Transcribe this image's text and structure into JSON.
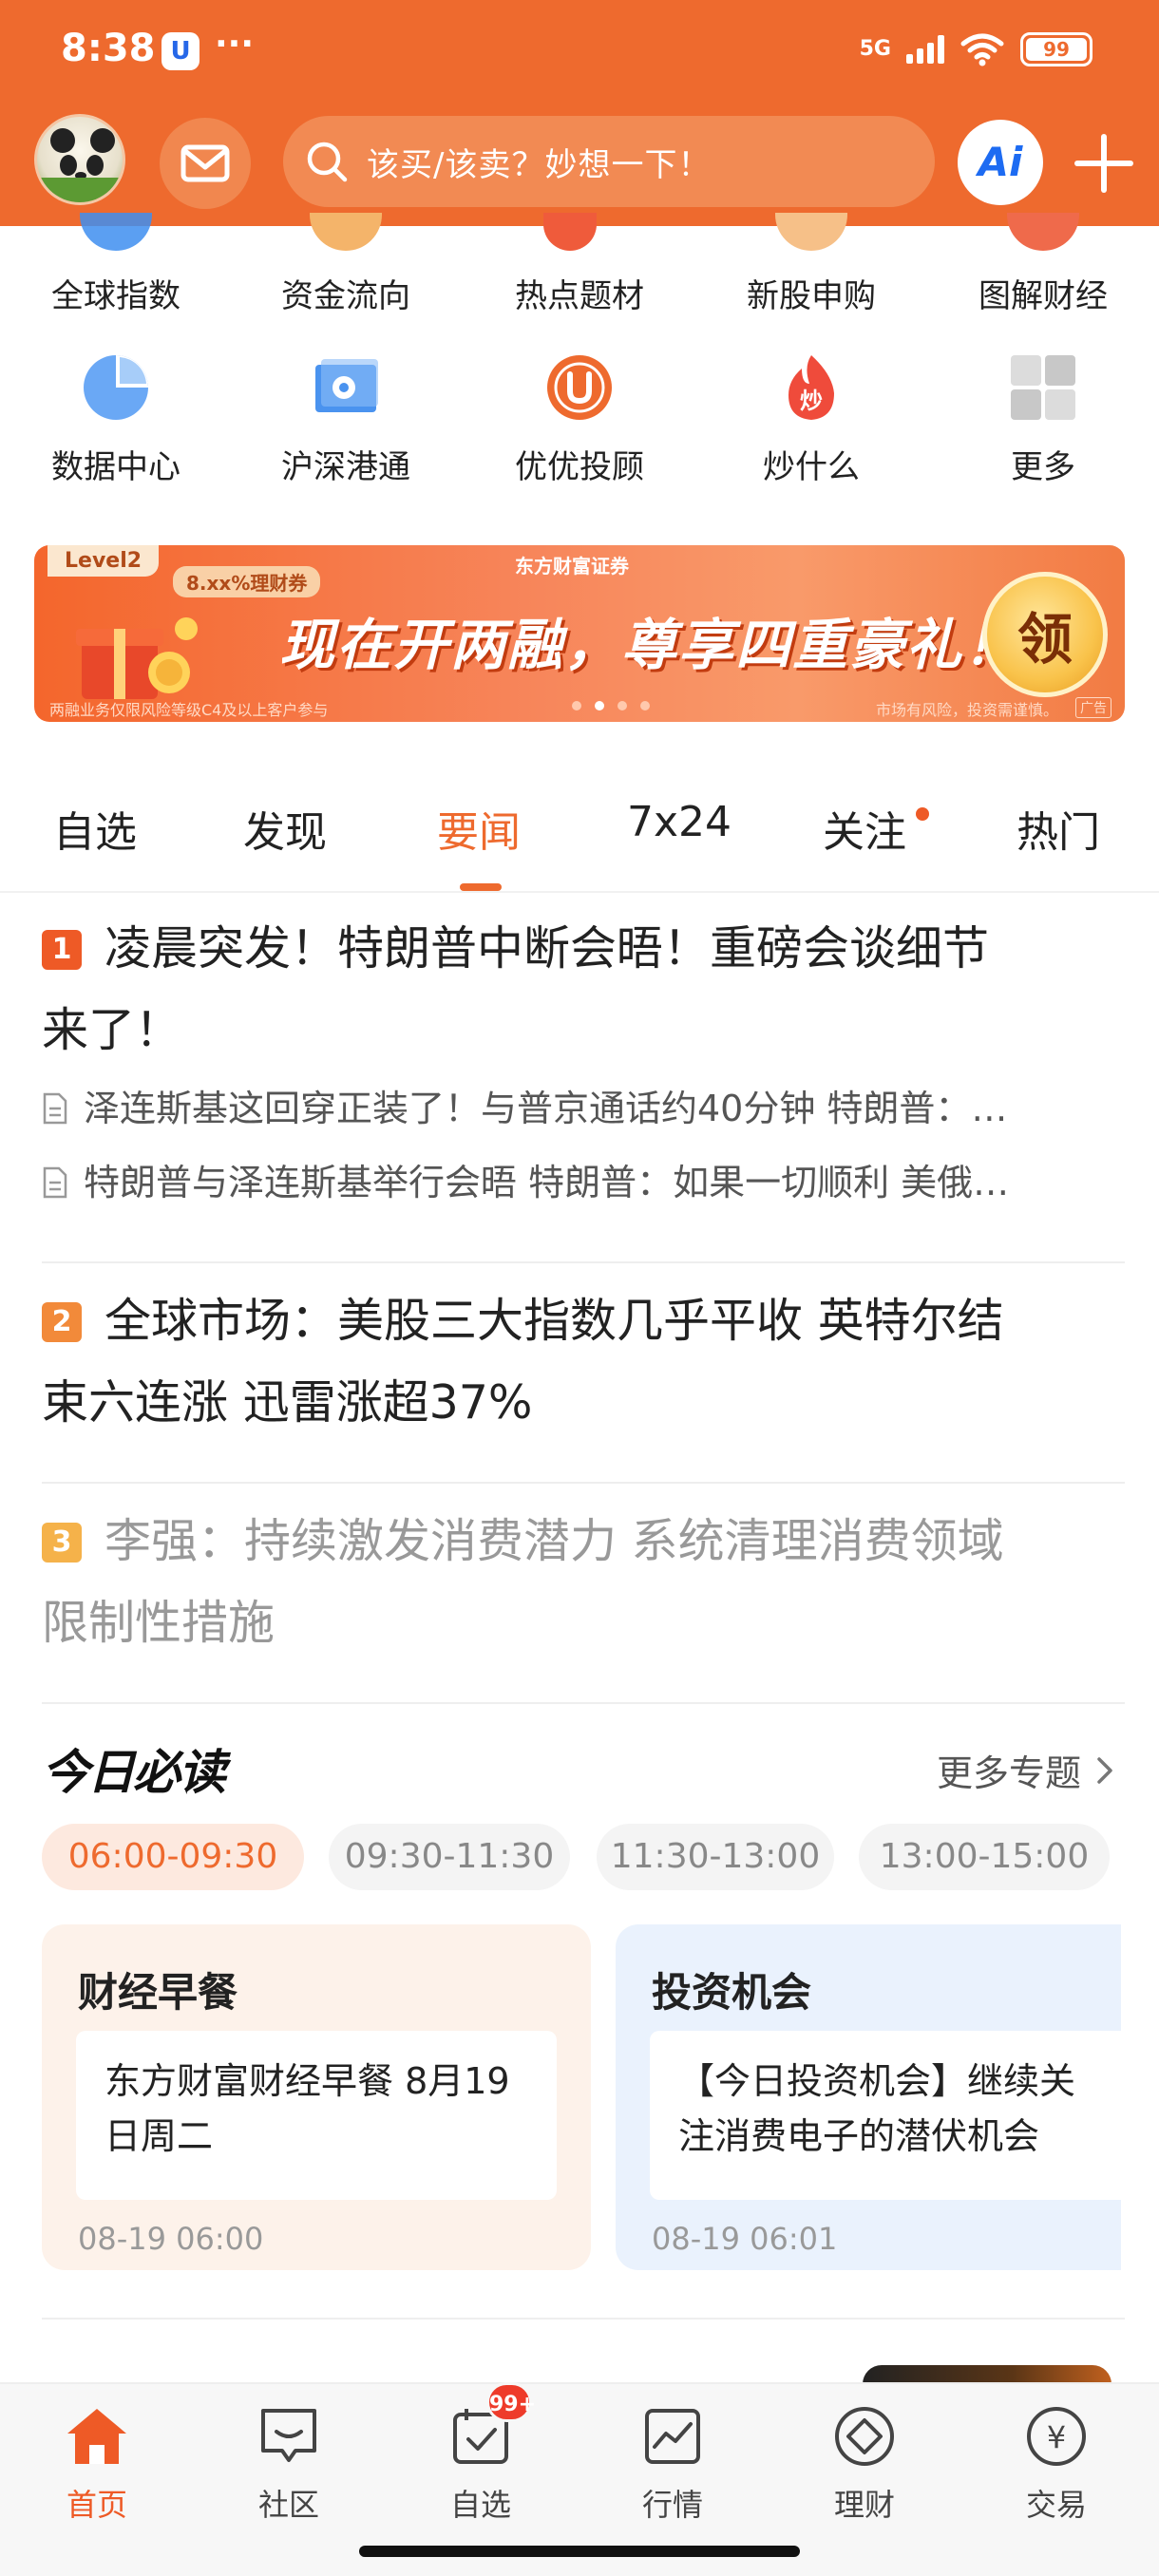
{
  "status_bar": {
    "time": "8:38",
    "dots": "···",
    "network": "5G",
    "battery": "99"
  },
  "header": {
    "search_placeholder": "该买/该卖？妙想一下！",
    "ai_label": "Ai"
  },
  "quick_grid": {
    "row1": [
      {
        "label": "全球指数",
        "icon": "globe-icon",
        "color": "#3e8ef0"
      },
      {
        "label": "资金流向",
        "icon": "coin-icon",
        "color": "#f4a24a"
      },
      {
        "label": "热点题材",
        "icon": "fire-icon",
        "color": "#ef5b3b"
      },
      {
        "label": "新股申购",
        "icon": "new-stock-icon",
        "color": "#f4a24a"
      },
      {
        "label": "图解财经",
        "icon": "chart-icon",
        "color": "#ef5b3b"
      }
    ],
    "row2": [
      {
        "label": "数据中心",
        "icon": "pie-chart-icon",
        "color": "#4a93ef"
      },
      {
        "label": "沪深港通",
        "icon": "hk-connect-icon",
        "color": "#4a93ef"
      },
      {
        "label": "优优投顾",
        "icon": "uu-advisor-icon",
        "color": "#ee6a2e"
      },
      {
        "label": "炒什么",
        "icon": "fire-chao-icon",
        "color": "#ef4b3b"
      },
      {
        "label": "更多",
        "icon": "grid-more-icon",
        "color": "#c9c9c9"
      }
    ]
  },
  "banner": {
    "tag": "Level2",
    "sub": "8.xx%理财券",
    "brand": "东方财富证券",
    "main": "现在开两融，尊享四重豪礼！",
    "receive": "领",
    "foot_left": "两融业务仅限风险等级C4及以上客户参与",
    "foot_right": "市场有风险，投资需谨慎。",
    "ad": "广告"
  },
  "tabs": [
    {
      "label": "自选"
    },
    {
      "label": "发现"
    },
    {
      "label": "要闻"
    },
    {
      "label": "7x24"
    },
    {
      "label": "关注"
    },
    {
      "label": "热门"
    }
  ],
  "news": [
    {
      "rank": "1",
      "color": "#ee5a26",
      "title_line1": "凌晨突发！特朗普中断会晤！重磅会谈细节",
      "title_line2": "来了！",
      "subs": [
        "泽连斯基这回穿正装了！与普京通话约40分钟 特朗普：…",
        "特朗普与泽连斯基举行会晤 特朗普：如果一切顺利 美俄…"
      ]
    },
    {
      "rank": "2",
      "color": "#f28a3a",
      "title_line1": "全球市场：美股三大指数几乎平收 英特尔结",
      "title_line2": "束六连涨 迅雷涨超37%"
    },
    {
      "rank": "3",
      "color": "#f5b24a",
      "title_line1": "李强：持续激发消费潜力 系统清理消费领域",
      "title_line2": "限制性措施"
    }
  ],
  "must_read": {
    "title": "今日必读",
    "more": "更多专题",
    "chips": [
      "06:00-09:30",
      "09:30-11:30",
      "11:30-13:00",
      "13:00-15:00"
    ],
    "cards": [
      {
        "title": "财经早餐",
        "line1": "东方财富财经早餐 8月19",
        "line2": "日周二",
        "time": "08-19 06:00",
        "bg": "#fdf2ea"
      },
      {
        "title": "投资机会",
        "line1": "【今日投资机会】继续关",
        "line2": "注消费电子的潜伏机会",
        "time": "08-19 06:01",
        "bg": "#eaf2fd"
      }
    ]
  },
  "bottom_nav": [
    {
      "label": "首页",
      "icon": "home-icon"
    },
    {
      "label": "社区",
      "icon": "community-icon"
    },
    {
      "label": "自选",
      "icon": "watchlist-icon"
    },
    {
      "label": "行情",
      "icon": "market-icon"
    },
    {
      "label": "理财",
      "icon": "wealth-icon"
    },
    {
      "label": "交易",
      "icon": "trade-icon"
    }
  ],
  "watchlist_badge": "99+"
}
